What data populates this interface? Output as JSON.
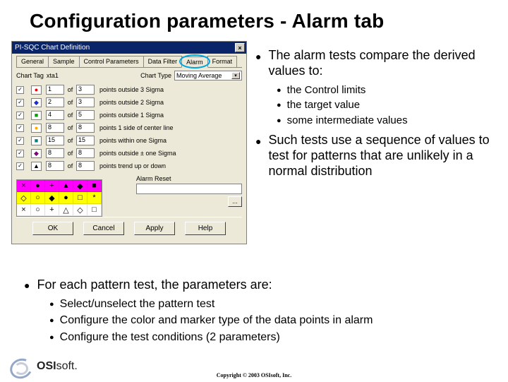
{
  "title": "Configuration parameters - Alarm tab",
  "dlg": {
    "title": "PI-SQC Chart Definition",
    "tabs": [
      "General",
      "Sample",
      "Control Parameters",
      "Data Filter",
      "Alarm",
      "Format"
    ],
    "active_tab": 4,
    "chart_tag_label": "Chart Tag",
    "chart_tag_value": "xta1",
    "chart_type_label": "Chart Type",
    "chart_type_value": "Moving Average",
    "rows": [
      {
        "checked": true,
        "marker_color": "#d80000",
        "marker_shape": "●",
        "n1": "1",
        "n2": "3",
        "desc": "points outside 3 Sigma"
      },
      {
        "checked": true,
        "marker_color": "#1a2bd8",
        "marker_shape": "◆",
        "n1": "2",
        "n2": "3",
        "desc": "points outside 2 Sigma"
      },
      {
        "checked": true,
        "marker_color": "#00a000",
        "marker_shape": "■",
        "n1": "4",
        "n2": "5",
        "desc": "points outside 1 Sigma"
      },
      {
        "checked": true,
        "marker_color": "#ffa500",
        "marker_shape": "●",
        "n1": "8",
        "n2": "8",
        "desc": "points 1 side of center line"
      },
      {
        "checked": true,
        "marker_color": "#008080",
        "marker_shape": "■",
        "n1": "15",
        "n2": "15",
        "desc": "points within one Sigma"
      },
      {
        "checked": true,
        "marker_color": "#800080",
        "marker_shape": "◆",
        "n1": "8",
        "n2": "8",
        "desc": "points outside ± one Sigma"
      },
      {
        "checked": true,
        "marker_color": "#000000",
        "marker_shape": "▲",
        "n1": "8",
        "n2": "8",
        "desc": "points trend up or down"
      }
    ],
    "of_label": "of",
    "palette": [
      {
        "bg": "#ff00ff",
        "cells": [
          "×",
          "●",
          "+",
          "▲",
          "◆",
          "■"
        ]
      },
      {
        "bg": "#ffff00",
        "cells": [
          "◇",
          "○",
          "◆",
          "●",
          "□",
          "*"
        ]
      },
      {
        "bg": "#ffffff",
        "cells": [
          "×",
          "○",
          "+",
          "△",
          "◇",
          "□"
        ]
      }
    ],
    "reset_label": "Alarm Reset",
    "browse": "...",
    "buttons": {
      "ok": "OK",
      "cancel": "Cancel",
      "apply": "Apply",
      "help": "Help"
    }
  },
  "right": {
    "b1": "The alarm tests compare the derived values to:",
    "subs": [
      "the Control limits",
      "the target value",
      "some intermediate values"
    ],
    "b2": "Such tests use a sequence of values to test for patterns that are unlikely in a normal distribution"
  },
  "lower": {
    "b1": "For each pattern test, the parameters are:",
    "subs": [
      "Select/unselect the pattern test",
      "Configure the color and marker type of the data points in alarm",
      "Configure the test conditions (2 parameters)"
    ]
  },
  "footer": {
    "logo1": "OSI",
    "logo2": "soft.",
    "copyright": "Copyright © 2003 OSIsoft, Inc."
  }
}
